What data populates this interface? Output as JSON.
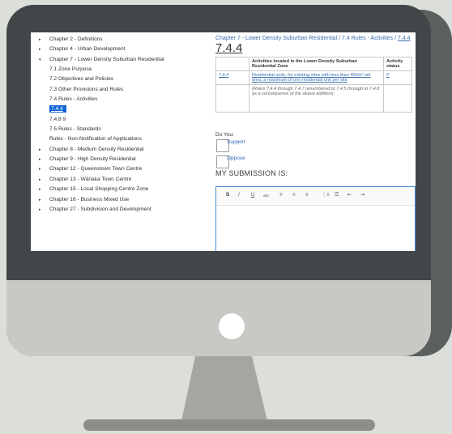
{
  "colors": {
    "background": "#dcdfd9",
    "monitor_frame": "#414748",
    "monitor_chin": "#c8c9c4",
    "accent": "#1565d8",
    "link": "#3a6fb0"
  },
  "sidebar": {
    "items": [
      {
        "label": "Chapter 2 - Definitions",
        "level": 0,
        "bullet": "▸"
      },
      {
        "label": "Chapter 4 - Urban Development",
        "level": 0,
        "bullet": "▸"
      },
      {
        "label": "Chapter 7 - Lower Density Suburban Residential",
        "level": 0,
        "bullet": "▾"
      },
      {
        "label": "7.1 Zone Purpose",
        "level": 1
      },
      {
        "label": "7.2 Objectives and Policies",
        "level": 1
      },
      {
        "label": "7.3 Other Provisions and Rules",
        "level": 1
      },
      {
        "label": "7.4 Rules - Activities",
        "level": 1
      },
      {
        "label": "7.4.4",
        "level": 1,
        "active": true
      },
      {
        "label": "7.4.8 9",
        "level": 1
      },
      {
        "label": "7.5 Rules - Standards",
        "level": 1
      },
      {
        "label": "Rules - Non-Notification of Applications",
        "level": 1
      },
      {
        "label": "Chapter 8 - Medium Density Residential",
        "level": 0,
        "bullet": "▸"
      },
      {
        "label": "Chapter 9 - High Density Residential",
        "level": 0,
        "bullet": "▸"
      },
      {
        "label": "Chapter 12 - Queenstown Town Centre",
        "level": 0,
        "bullet": "▸"
      },
      {
        "label": "Chapter 13 - Wānaka Town Centre",
        "level": 0,
        "bullet": "▸"
      },
      {
        "label": "Chapter 15 - Local Shopping Centre Zone",
        "level": 0,
        "bullet": "▸"
      },
      {
        "label": "Chapter 16 - Business Mixed Use",
        "level": 0,
        "bullet": "▸"
      },
      {
        "label": "Chapter 27 - Subdivision and Development",
        "level": 0,
        "bullet": "▸"
      }
    ]
  },
  "main": {
    "breadcrumb": {
      "prefix": "Chapter 7 - Lower Density Suburban Residential / 7.4 Rules - Activities / ",
      "current": "7.4.4"
    },
    "title": "7.4.4",
    "table": {
      "headers": [
        "",
        "Activities located in the Lower Density Suburban Residential Zone",
        "Activity status"
      ],
      "rows": [
        {
          "rule": "7.4.4",
          "text": "Residential units, for existing sites with less than 450m² net area, a maximum of one residential unit per site",
          "status": "P"
        },
        {
          "rule": "",
          "text": "(Rules 7.4.4 through 7.4.7 renumbered to 7.4.5 through to 7.4.8 as a consequence of the above addition)",
          "status": ""
        }
      ]
    },
    "do_you": "Do You:",
    "support_label": "Support",
    "oppose_label": "Oppose",
    "submission_label": "MY SUBMISSION IS:",
    "toolbar": [
      "B",
      "I",
      "U",
      "abc",
      "≡",
      "≡",
      "≡",
      "⋮≡",
      "☰",
      "⇤",
      "⇥"
    ]
  }
}
